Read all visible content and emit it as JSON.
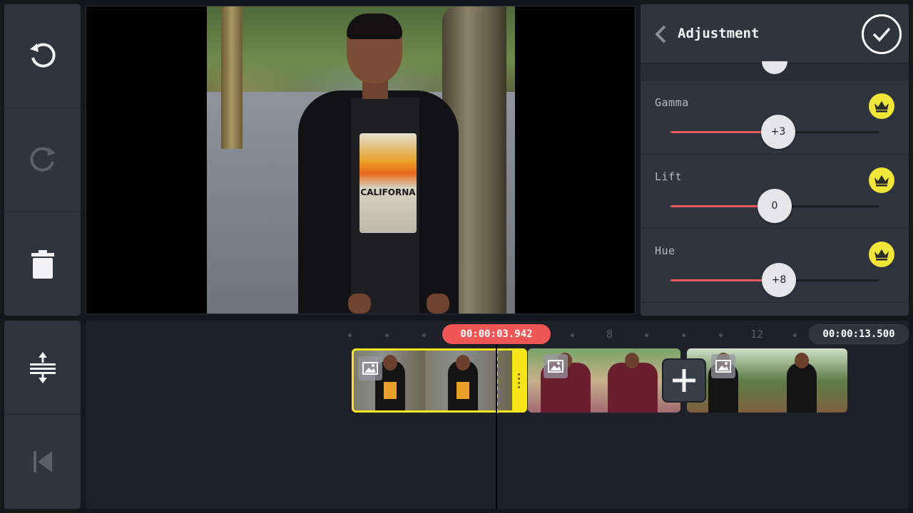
{
  "toolbar": {
    "undo": "undo-icon",
    "redo": "redo-icon",
    "delete": "trash-icon",
    "split": "split-icon",
    "to_start": "skip-to-start-icon"
  },
  "preview": {
    "shirt_print": "CALIFORNA"
  },
  "panel": {
    "title": "Adjustment",
    "confirm": "check-icon",
    "back": "chevron-left-icon",
    "rows": [
      {
        "label": "Gamma",
        "value_label": "+3",
        "value": 3,
        "fill_fraction": 0.52,
        "premium": "crown-icon"
      },
      {
        "label": "Lift",
        "value_label": "0",
        "value": 0,
        "fill_fraction": 0.5,
        "premium": "crown-icon"
      },
      {
        "label": "Hue",
        "value_label": "+8",
        "value": 8,
        "fill_fraction": 0.52,
        "premium": "crown-icon"
      }
    ]
  },
  "timeline": {
    "current_time": "00:00:03.942",
    "total_time": "00:00:13.500",
    "ruler_labels": [
      "8",
      "12"
    ],
    "add_button": "plus-icon",
    "clips": [
      {
        "type": "image",
        "selected": true
      },
      {
        "type": "image",
        "selected": false
      },
      {
        "type": "image",
        "selected": false
      }
    ]
  },
  "colors": {
    "accent_red": "#f05656",
    "selection_yellow": "#f7e41b",
    "premium_gold": "#f2e53a",
    "panel_bg": "#30343f"
  }
}
